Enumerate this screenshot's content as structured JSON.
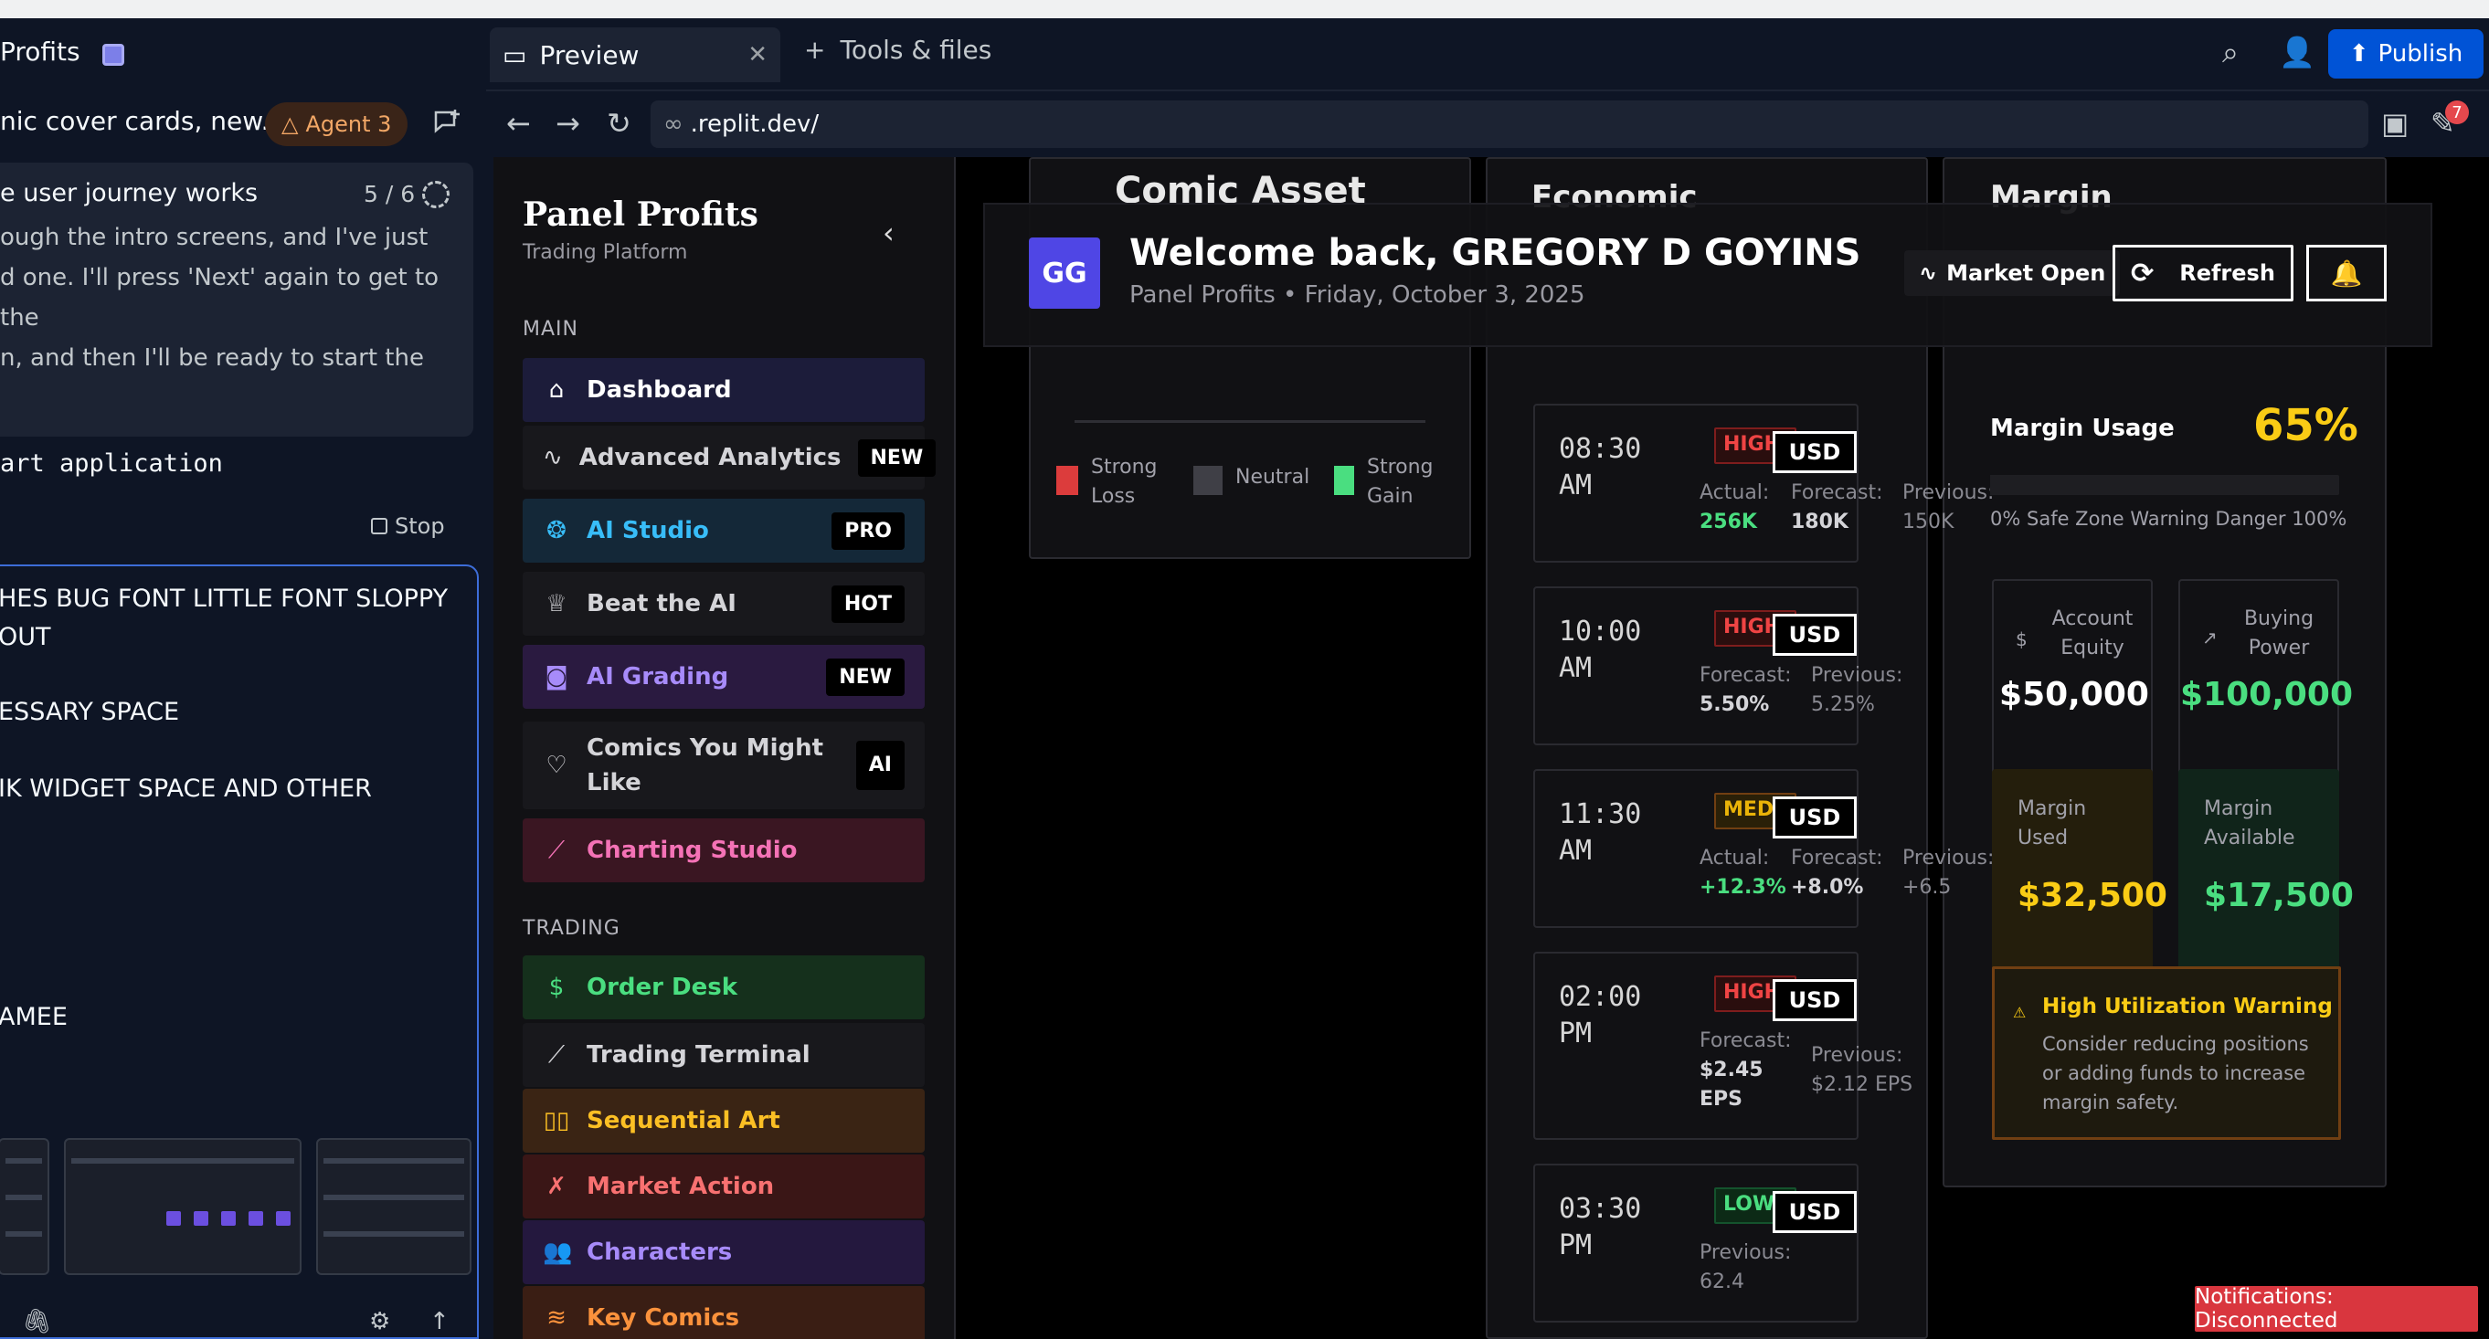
{
  "agent": {
    "project_title": "Profits",
    "thread_title": "nic cover cards, new...",
    "agent_badge": "Agent 3",
    "progress_text": "e user journey works",
    "progress_count": "5 / 6",
    "message_lines": [
      "ough the intro screens, and I've just",
      "d one. I'll press 'Next' again to get to the",
      "n, and then I'll be ready to start the"
    ],
    "command": "art application",
    "stop_label": "Stop",
    "input_lines": [
      "HES BUG FONT LITTLE FONT SLOPPY",
      "OUT",
      "ESSARY SPACE",
      "IK WIDGET SPACE AND OTHER",
      "AMEE"
    ]
  },
  "topbar": {
    "preview_tab": "Preview",
    "tools_tab": "Tools & files",
    "publish_label": "Publish",
    "url": ".replit.dev/",
    "notification_count": "7"
  },
  "sidebar": {
    "brand": "Panel Profits",
    "brand_sub": "Trading Platform",
    "main_section": "MAIN",
    "trading_section": "TRADING",
    "main_items": [
      {
        "label": "Dashboard",
        "tag": ""
      },
      {
        "label": "Advanced Analytics",
        "tag": "NEW"
      },
      {
        "label": "AI Studio",
        "tag": "PRO"
      },
      {
        "label": "Beat the AI",
        "tag": "HOT"
      },
      {
        "label": "AI Grading",
        "tag": "NEW"
      },
      {
        "label": "Comics You Might Like",
        "tag": "AI"
      },
      {
        "label": "Charting Studio",
        "tag": ""
      }
    ],
    "trading_items": [
      {
        "label": "Order Desk"
      },
      {
        "label": "Trading Terminal"
      },
      {
        "label": "Sequential Art"
      },
      {
        "label": "Market Action"
      },
      {
        "label": "Characters"
      },
      {
        "label": "Key Comics"
      }
    ]
  },
  "header": {
    "avatar_initials": "GG",
    "welcome": "Welcome back, GREGORY D GOYINS",
    "subtitle": "Panel Profits • Friday, October 3, 2025",
    "market_status": "Market Open",
    "refresh_label": "Refresh"
  },
  "cards": {
    "comic_title": "Comic Asset",
    "econ_title": "Economic",
    "margin_title": "Margin"
  },
  "legend": {
    "strong_loss": "Strong Loss",
    "neutral": "Neutral",
    "strong_gain": "Strong Gain"
  },
  "economic_events": [
    {
      "time": "08:30 AM",
      "priority": "HIGH",
      "currency": "USD",
      "a_label": "Actual:",
      "a_value": "256K",
      "b_label": "Forecast:",
      "b_value": "180K",
      "c_label": "Previous:",
      "c_value": "150K"
    },
    {
      "time": "10:00 AM",
      "priority": "HIGH",
      "currency": "USD",
      "a_label": "Forecast:",
      "a_value": "5.50%",
      "b_label": "Previous:",
      "b_value": "5.25%",
      "c_label": "",
      "c_value": ""
    },
    {
      "time": "11:30 AM",
      "priority": "MED",
      "currency": "USD",
      "a_label": "Actual:",
      "a_value": "+12.3%",
      "b_label": "Forecast:",
      "b_value": "+8.0%",
      "c_label": "Previous:",
      "c_value": "+6.5"
    },
    {
      "time": "02:00 PM",
      "priority": "HIGH",
      "currency": "USD",
      "a_label": "Forecast:",
      "a_value": "$2.45 EPS",
      "b_label": "Previous:",
      "b_value": "$2.12 EPS",
      "c_label": "",
      "c_value": ""
    },
    {
      "time": "03:30 PM",
      "priority": "LOW",
      "currency": "USD",
      "a_label": "Previous:",
      "a_value": "62.4",
      "b_label": "",
      "b_value": "",
      "c_label": "",
      "c_value": ""
    }
  ],
  "margin": {
    "usage_label": "Margin Usage",
    "usage_value": "65%",
    "usage_fraction": 0.65,
    "scale": "0% Safe Zone Warning Danger 100%",
    "equity_label": "Account Equity",
    "equity_value": "$50,000",
    "buying_label": "Buying Power",
    "buying_value": "$100,000",
    "used_label": "Margin Used",
    "used_value": "$32,500",
    "available_label": "Margin Available",
    "available_value": "$17,500",
    "warning_title": "High Utilization Warning",
    "warning_text": "Consider reducing positions or adding funds to increase margin safety."
  },
  "notification": "Notifications: Disconnected",
  "colors": {
    "accent": "#4f46e5",
    "gain": "#4ade80",
    "loss": "#ef4444",
    "warning": "#facc15",
    "publish": "#0053d6"
  }
}
